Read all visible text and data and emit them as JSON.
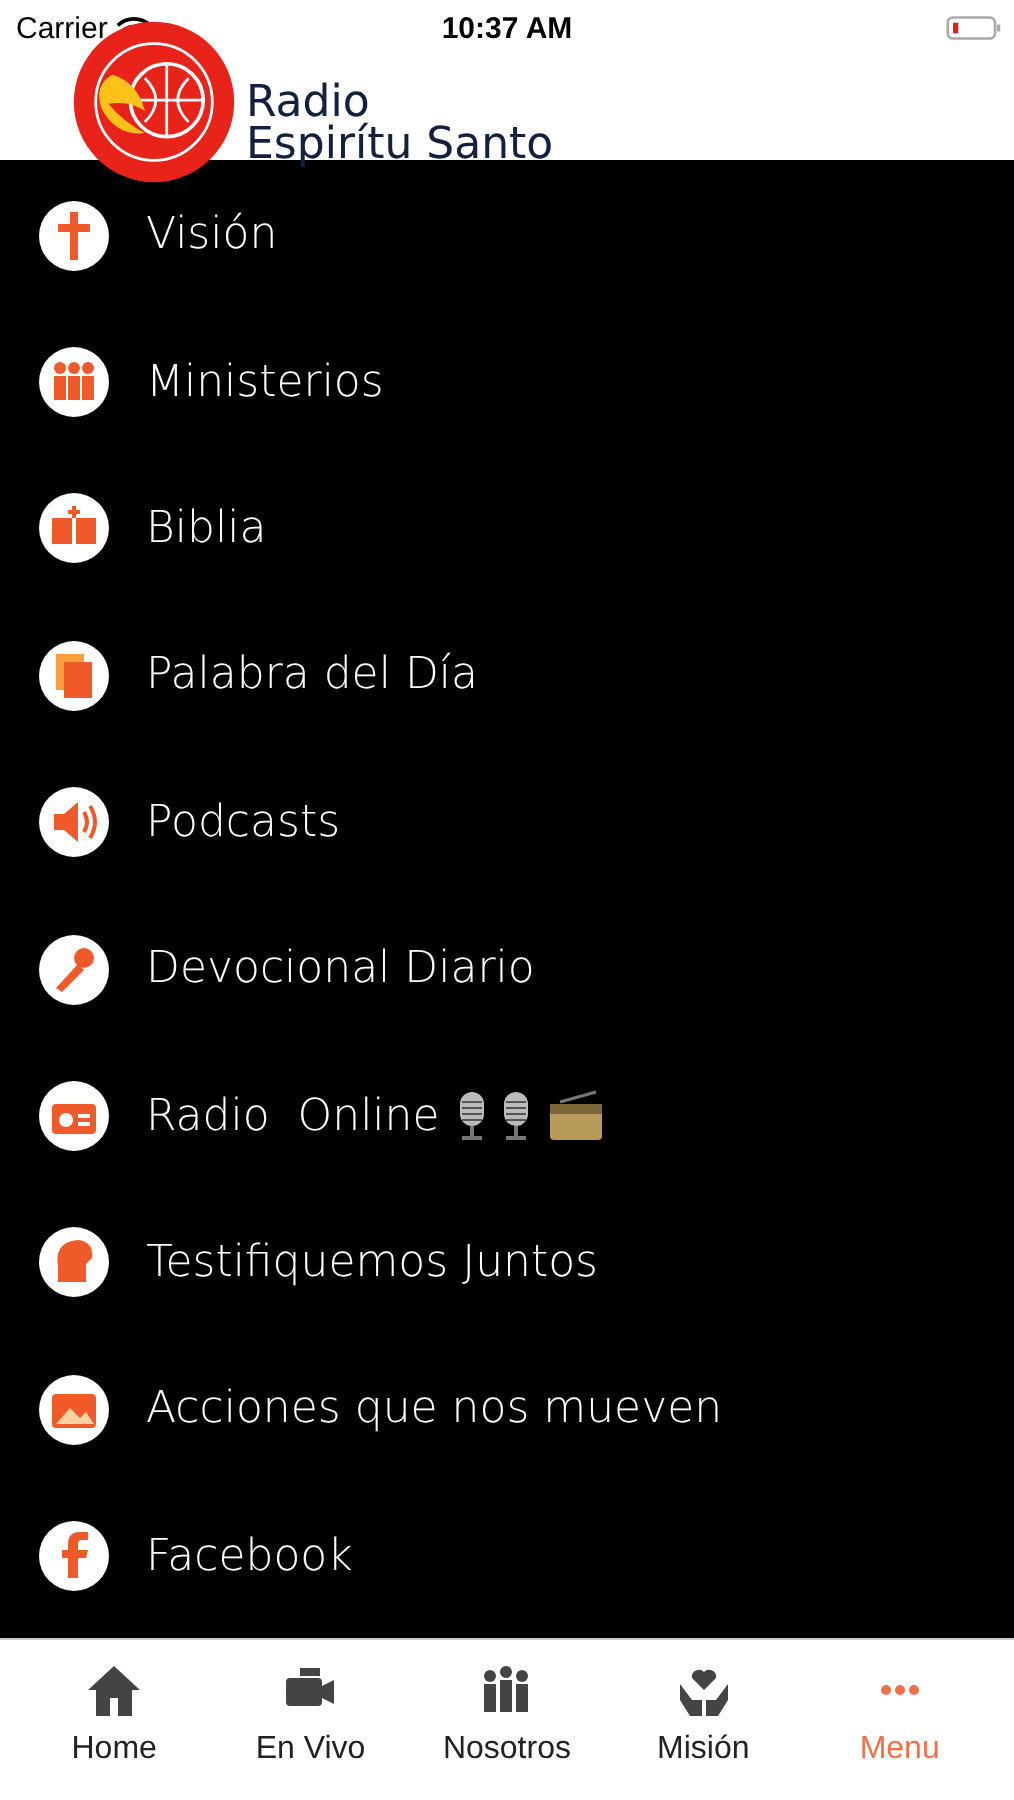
{
  "status_bar": {
    "carrier": "Carrier",
    "time": "10:37 AM"
  },
  "header": {
    "title_line_1": "Radio",
    "title_line_2": "Espirítu Santo"
  },
  "menu_items": [
    {
      "label": "Visión"
    },
    {
      "label": "Ministerios"
    },
    {
      "label": "Biblia"
    },
    {
      "label": "Palabra del Día"
    },
    {
      "label": "Podcasts"
    },
    {
      "label": "Devocional Diario"
    },
    {
      "label": "Radio  Online",
      "extras": true
    },
    {
      "label": "Testifiquemos Juntos"
    },
    {
      "label": "Acciones que nos mueven"
    },
    {
      "label": "Facebook"
    }
  ],
  "tabs": [
    {
      "label": "Home",
      "selected": false
    },
    {
      "label": "En Vivo",
      "selected": false
    },
    {
      "label": "Nosotros",
      "selected": false
    },
    {
      "label": "Misión",
      "selected": false
    },
    {
      "label": "Menu",
      "selected": true
    }
  ]
}
